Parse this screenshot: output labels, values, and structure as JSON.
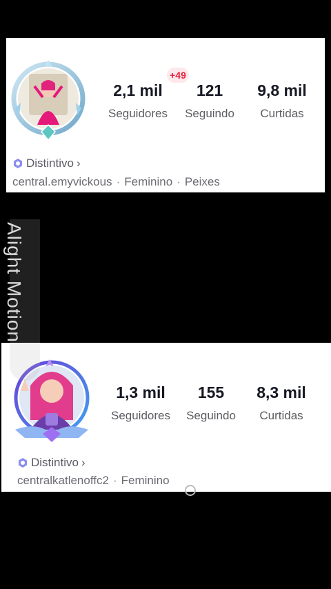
{
  "profile1": {
    "followers_count": "2,1 mil",
    "followers_label": "Seguidores",
    "following_count": "121",
    "following_label": "Seguindo",
    "likes_count": "9,8 mil",
    "likes_label": "Curtidas",
    "new_followers_badge": "+49",
    "badge_label": "Distintivo",
    "badge_chevron": "›",
    "username": "central.emyvickous",
    "gender": "Feminino",
    "sign": "Peixes",
    "separator": "·"
  },
  "profile2": {
    "followers_count": "1,3 mil",
    "followers_label": "Seguidores",
    "following_count": "155",
    "following_label": "Seguindo",
    "likes_count": "8,3 mil",
    "likes_label": "Curtidas",
    "badge_label": "Distintivo",
    "badge_chevron": "›",
    "username": "centralkatlenoffc2",
    "gender": "Feminino",
    "separator": "·"
  },
  "watermark": {
    "text": "Alight Motion"
  },
  "colors": {
    "background": "#000000",
    "card": "#ffffff",
    "badge_red": "#e5253f",
    "badge_pink_bg": "#fde8ec",
    "distintivo_icon": "#8a8ef0"
  }
}
